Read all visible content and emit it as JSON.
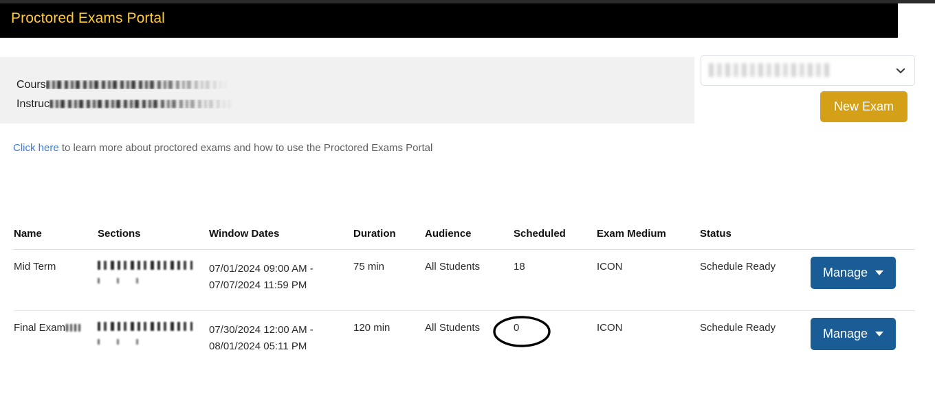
{
  "app": {
    "title": "Proctored Exams Portal",
    "header_bg": "#000000",
    "title_color": "#ffcc33"
  },
  "info_panel": {
    "course_label": "Cours",
    "instructor_label": "Instruc",
    "course_value_redacted": true,
    "instructor_value_redacted": true
  },
  "course_select": {
    "value": "",
    "value_redacted": true,
    "icon": "chevron-down-icon"
  },
  "toolbar": {
    "new_exam_label": "New Exam",
    "new_exam_color": "#d4a017"
  },
  "help": {
    "link_text": "Click here",
    "link_color": "#3b7ddd",
    "rest_text": " to learn more about proctored exams and how to use the Proctored Exams Portal"
  },
  "table": {
    "columns": [
      "Name",
      "Sections",
      "Window Dates",
      "Duration",
      "Audience",
      "Scheduled",
      "Exam Medium",
      "Status",
      ""
    ],
    "rows": [
      {
        "name": "Mid Term",
        "name_has_redaction": false,
        "sections": "",
        "sections_redacted": true,
        "window_start": "07/01/2024 09:00 AM -",
        "window_end": "07/07/2024 11:59 PM",
        "duration": "75 min",
        "audience": "All Students",
        "scheduled": "18",
        "scheduled_highlighted": false,
        "exam_medium": "ICON",
        "status": "Schedule Ready",
        "action_label": "Manage"
      },
      {
        "name": "Final Exam",
        "name_has_redaction": true,
        "sections": "",
        "sections_redacted": true,
        "window_start": "07/30/2024 12:00 AM -",
        "window_end": "08/01/2024 05:11 PM",
        "duration": "120 min",
        "audience": "All Students",
        "scheduled": "0",
        "scheduled_highlighted": true,
        "exam_medium": "ICON",
        "status": "Schedule Ready",
        "action_label": "Manage"
      }
    ],
    "action_button_color": "#1a5c96"
  },
  "annotation": {
    "shape": "ellipse",
    "color": "#000000",
    "target": "scheduled value 0 of Final Exam row"
  }
}
